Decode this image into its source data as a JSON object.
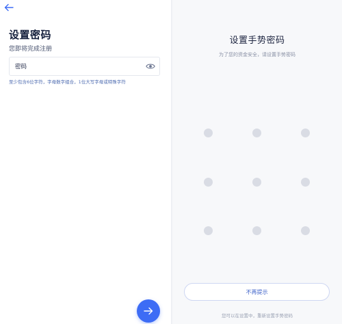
{
  "register": {
    "title": "设置密码",
    "subtitle": "您即将完成注册",
    "password_placeholder": "密码",
    "password_hint": "至少包含6位字符，字母数字组合，1位大写字母或特殊字符",
    "icons": {
      "back": "arrow-left-icon",
      "visibility": "eye-icon",
      "next": "arrow-right-icon"
    }
  },
  "gesture": {
    "title": "设置手势密码",
    "subtitle": "为了您的资金安全，请设置手势密码",
    "skip_label": "不再提示",
    "footer_note": "您可以在设置中，重新设置手势密码",
    "grid": {
      "rows": 3,
      "cols": 3
    }
  },
  "colors": {
    "accent": "#3d6cf5",
    "title_text": "#15203d",
    "hint_text": "#4d6bb0",
    "dot": "#d9dce4",
    "right_background": "#f7f8fa"
  }
}
